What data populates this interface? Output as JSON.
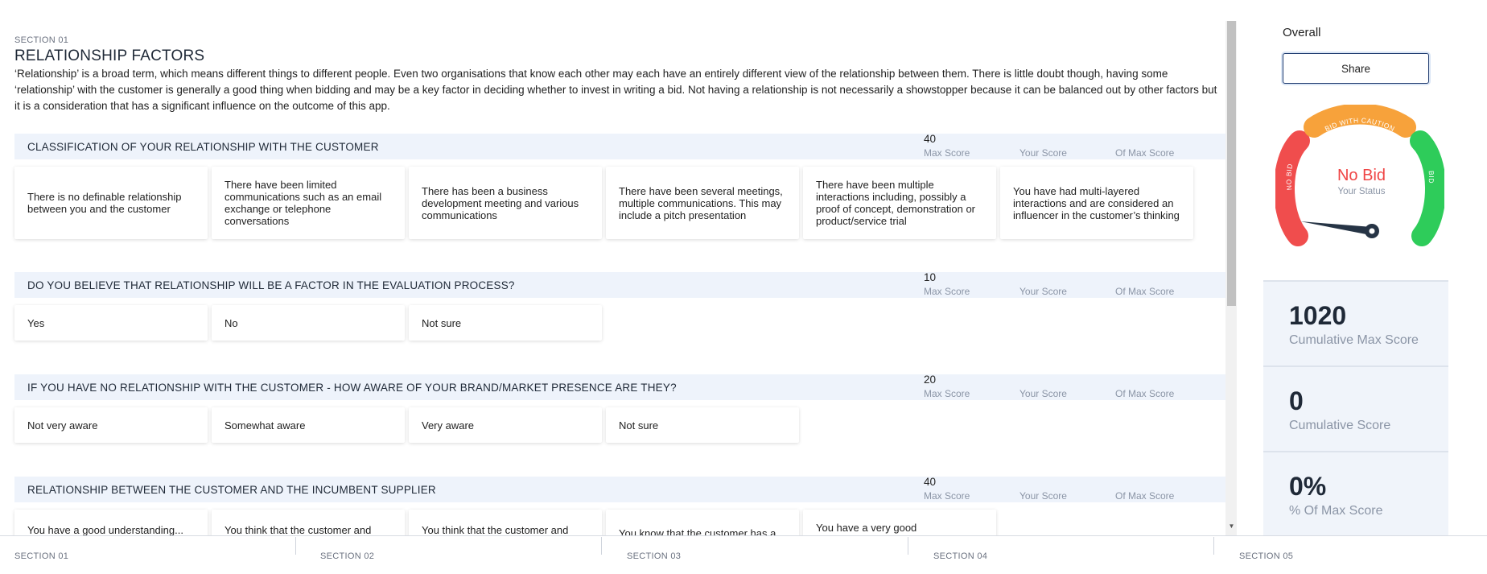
{
  "section": {
    "label": "SECTION 01",
    "title": "RELATIONSHIP FACTORS",
    "description": "‘Relationship’ is a broad term, which means different things to different people. Even two organisations that know each other may each have an entirely different view of the relationship between them. There is little doubt though, having some ‘relationship’ with the customer is generally a good thing when bidding and may be a key factor in deciding whether to invest in writing a bid. Not having a relationship is not necessarily a showstopper because it can be balanced out by other factors but it is a consideration that has a significant influence on the outcome of this app."
  },
  "score_labels": {
    "max": "Max Score",
    "yours": "Your Score",
    "of_max": "Of Max Score"
  },
  "questions": [
    {
      "title": "CLASSIFICATION OF YOUR RELATIONSHIP WITH THE CUSTOMER",
      "max_score": "40",
      "options": [
        "There is no definable relationship between you and the customer",
        "There have been limited communications such as an email exchange or telephone conversations",
        "There has been a business development meeting and various communications",
        "There have been several meetings, multiple communications. This may include a pitch presentation",
        "There have been multiple interactions including, possibly a proof of concept, demonstration or product/service trial",
        "You have had multi-layered interactions and are considered an influencer in the customer’s thinking"
      ]
    },
    {
      "title": "DO YOU BELIEVE THAT RELATIONSHIP WILL BE A FACTOR IN THE EVALUATION PROCESS?",
      "max_score": "10",
      "options": [
        "Yes",
        "No",
        "Not sure"
      ]
    },
    {
      "title": "IF YOU HAVE NO RELATIONSHIP WITH THE CUSTOMER - HOW AWARE OF YOUR BRAND/MARKET PRESENCE ARE THEY?",
      "max_score": "20",
      "options": [
        "Not very aware",
        "Somewhat aware",
        "Very aware",
        "Not sure"
      ]
    },
    {
      "title": "RELATIONSHIP BETWEEN THE CUSTOMER AND THE INCUMBENT SUPPLIER",
      "max_score": "40",
      "options": [
        "You have a good understanding...",
        "You think that the customer and the...",
        "You think that the customer and the...",
        "You know that the customer has a good relationship...",
        "You have a very good understanding of the relationship..."
      ]
    }
  ],
  "panel": {
    "overall": "Overall",
    "share": "Share",
    "gauge": {
      "status": "No Bid",
      "status_label": "Your Status",
      "left_label": "NO BID",
      "top_label": "BID WITH CAUTION",
      "right_label": "BID",
      "colors": {
        "no_bid": "#f04d4d",
        "caution": "#f7a23b",
        "bid": "#2ecc5a",
        "needle": "#263445"
      }
    },
    "stats": [
      {
        "value": "1020",
        "label": "Cumulative Max Score"
      },
      {
        "value": "0",
        "label": "Cumulative Score"
      },
      {
        "value": "0%",
        "label": "% Of Max Score"
      }
    ]
  },
  "section_tabs": [
    "SECTION 01",
    "SECTION 02",
    "SECTION 03",
    "SECTION 04",
    "SECTION 05"
  ]
}
